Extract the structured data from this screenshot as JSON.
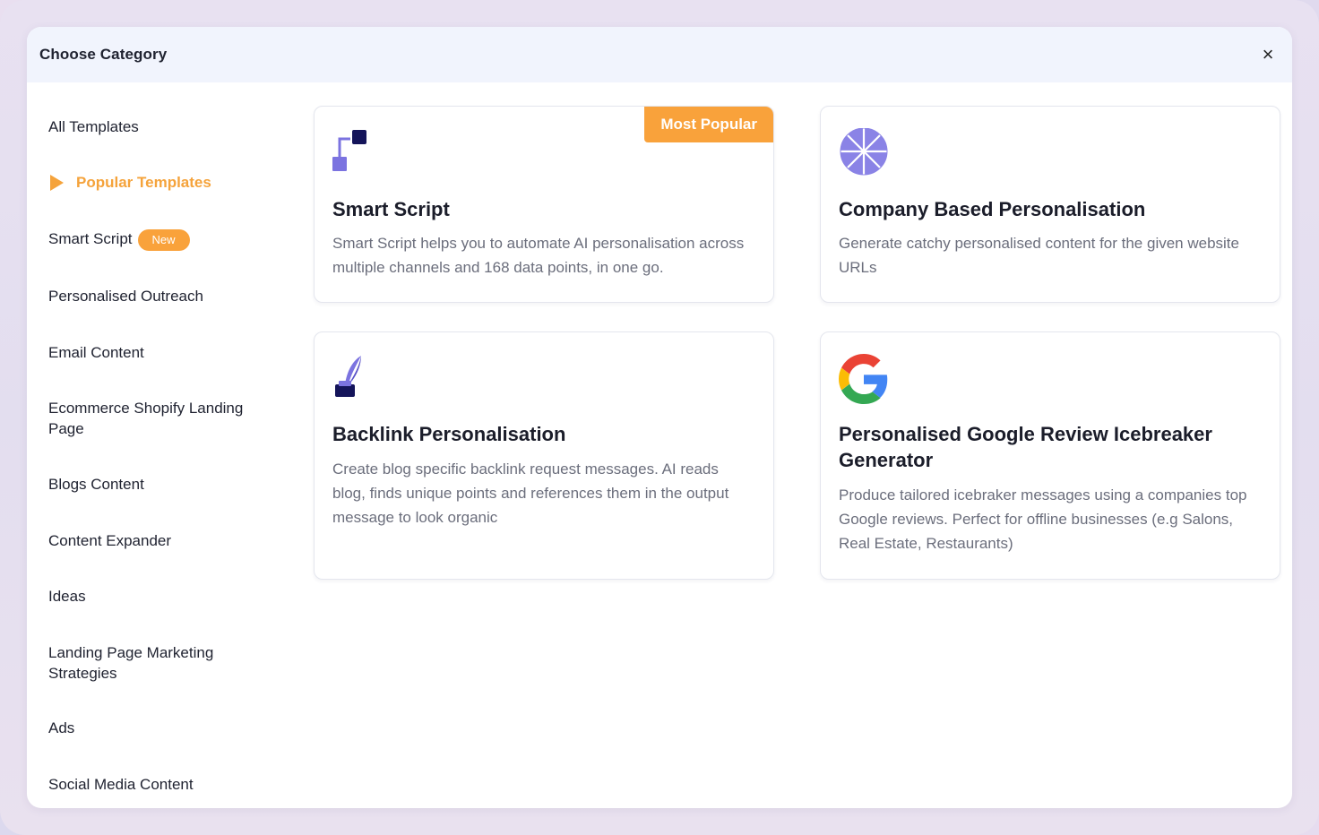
{
  "modal": {
    "title": "Choose Category",
    "close_label": "×"
  },
  "sidebar": {
    "items": [
      {
        "label": "All Templates"
      },
      {
        "label": "Popular Templates",
        "active": true
      },
      {
        "label": "Smart Script",
        "badge": "New"
      },
      {
        "label": "Personalised Outreach"
      },
      {
        "label": "Email Content"
      },
      {
        "label": "Ecommerce Shopify Landing Page"
      },
      {
        "label": "Blogs Content"
      },
      {
        "label": "Content Expander"
      },
      {
        "label": "Ideas"
      },
      {
        "label": "Landing Page Marketing Strategies"
      },
      {
        "label": "Ads"
      },
      {
        "label": "Social Media Content"
      }
    ]
  },
  "cards": [
    {
      "title": "Smart Script",
      "description": "Smart Script helps you to automate AI personalisation across multiple channels and 168 data points, in one go.",
      "badge": "Most Popular",
      "icon": "smart-script-icon"
    },
    {
      "title": "Company Based Personalisation",
      "description": "Generate catchy personalised content for the given website URLs",
      "icon": "company-wheel-icon"
    },
    {
      "title": "Backlink Personalisation",
      "description": "Create blog specific backlink request messages. AI reads blog, finds unique points and references them in the output message to look organic",
      "icon": "quill-ink-icon"
    },
    {
      "title": "Personalised Google Review Icebreaker Generator",
      "description": "Produce tailored icebraker messages using a companies top Google reviews. Perfect for offline businesses (e.g Salons, Real Estate, Restaurants)",
      "icon": "google-g-icon"
    }
  ],
  "colors": {
    "accent": "#f9a23b",
    "header_bg": "#f1f4fd",
    "icon_purple": "#7b73e0",
    "icon_navy": "#14145a"
  }
}
